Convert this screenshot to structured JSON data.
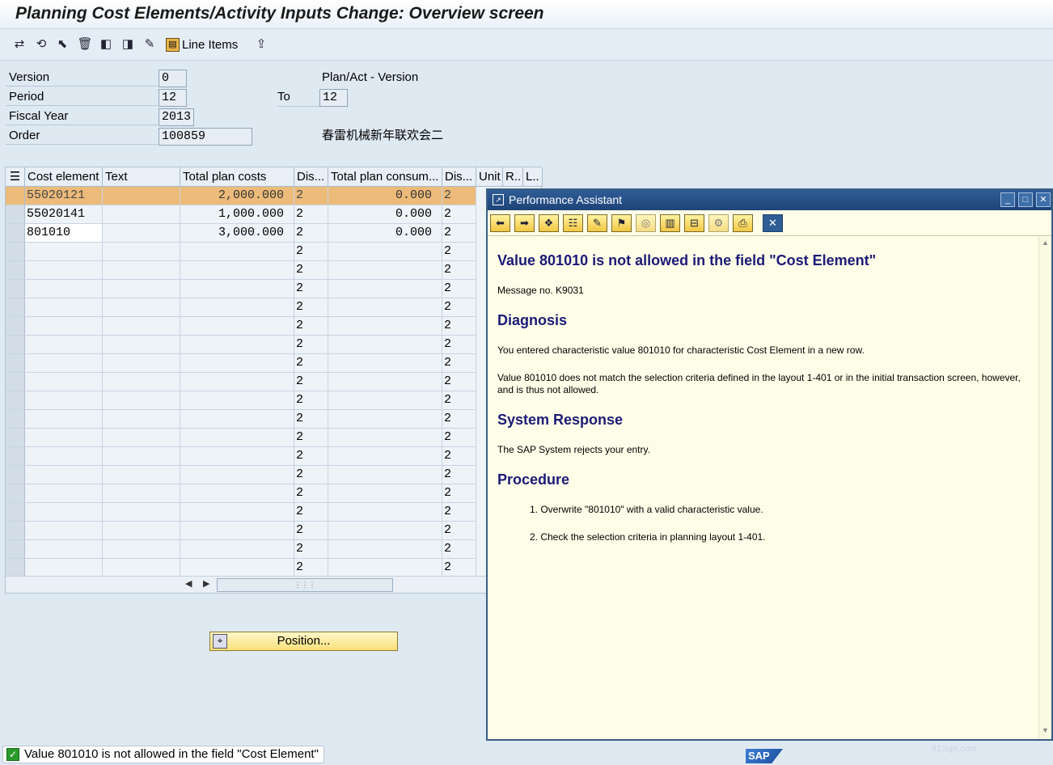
{
  "window": {
    "title": "Planning Cost Elements/Activity Inputs Change: Overview screen"
  },
  "toolbar": {
    "icons": [
      "change-layout-icon",
      "refresh-icon",
      "select-icon",
      "delete-icon",
      "previous-icon",
      "next-icon",
      "edit-icon"
    ],
    "line_items_label": "Line Items",
    "extra_icon": "export-icon"
  },
  "form": {
    "version_label": "Version",
    "version_value": "0",
    "version_text": "Plan/Act - Version",
    "period_label": "Period",
    "period_from": "12",
    "period_to_label": "To",
    "period_to": "12",
    "fiscal_year_label": "Fiscal Year",
    "fiscal_year_value": "2013",
    "order_label": "Order",
    "order_value": "100859",
    "order_text": "春雷机械新年联欢会二"
  },
  "grid": {
    "columns": [
      "Cost element",
      "Text",
      "Total plan costs",
      "Dis...",
      "Total plan consum...",
      "Dis...",
      "Unit",
      "R..",
      "L.."
    ],
    "rows": [
      {
        "cost_element": "55020121",
        "text": "",
        "total_plan_costs": "2,000.000",
        "dis1": "2",
        "total_plan_consum": "0.000",
        "dis2": "2"
      },
      {
        "cost_element": "55020141",
        "text": "",
        "total_plan_costs": "1,000.000",
        "dis1": "2",
        "total_plan_consum": "0.000",
        "dis2": "2"
      },
      {
        "cost_element": "801010",
        "text": "",
        "total_plan_costs": "3,000.000",
        "dis1": "2",
        "total_plan_consum": "0.000",
        "dis2": "2"
      }
    ],
    "empty_row_dis": "2",
    "empty_row_count": 18
  },
  "position_button": {
    "label": "Position..."
  },
  "status_bar": {
    "message": "Value 801010 is not allowed in the field \"Cost Element\"",
    "logo": "SAP"
  },
  "watermark": "91Sqn.com",
  "performance_assistant": {
    "title": "Performance Assistant",
    "toolbar_icons": [
      "back-icon",
      "forward-icon",
      "book-icon",
      "technical-info-icon",
      "edit-icon",
      "filter-icon",
      "glasses-icon",
      "document-icon",
      "link-icon",
      "settings-icon",
      "print-icon",
      "close-window-icon"
    ],
    "heading": "Value 801010 is not allowed in the field \"Cost Element\"",
    "message_no": "Message no. K9031",
    "diagnosis_heading": "Diagnosis",
    "diagnosis_text_1": "You entered characteristic value 801010 for characteristic Cost Element in a new row.",
    "diagnosis_text_2": "Value 801010 does not match the selection criteria defined in the layout 1-401 or in the initial transaction screen, however, and is thus not allowed.",
    "system_response_heading": "System Response",
    "system_response_text": "The SAP System rejects your entry.",
    "procedure_heading": "Procedure",
    "procedure_steps": [
      "1. Overwrite \"801010\" with a valid characteristic value.",
      "2. Check the selection criteria in planning layout 1-401."
    ]
  }
}
